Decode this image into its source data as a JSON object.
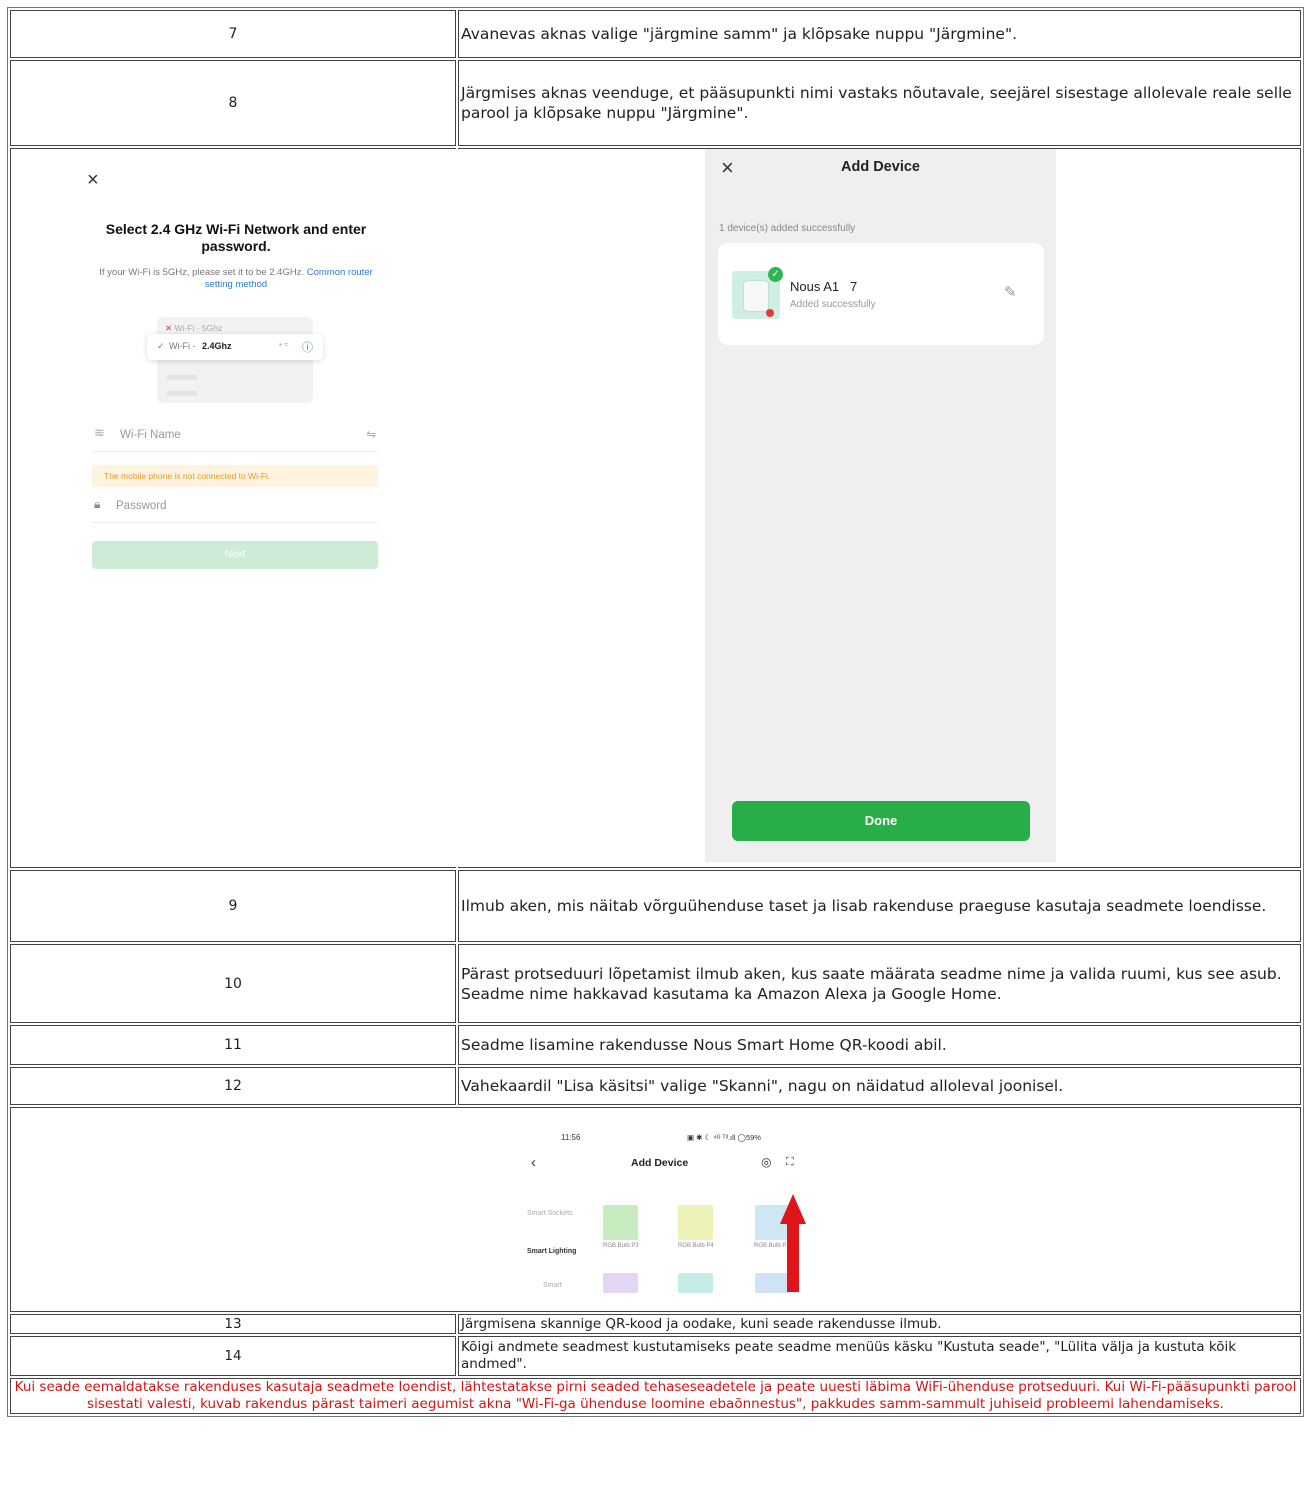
{
  "steps": {
    "s7": {
      "num": "7",
      "text": "Avanevas aknas valige \"järgmine samm\" ja klõpsake nuppu \"Järgmine\"."
    },
    "s8": {
      "num": "8",
      "text": "Järgmises aknas veenduge, et pääsupunkti nimi vastaks nõutavale, seejärel sisestage allolevale reale selle parool ja klõpsake nuppu \"Järgmine\"."
    },
    "s9": {
      "num": "9",
      "text": "Ilmub aken, mis näitab võrguühenduse taset ja lisab rakenduse praeguse kasutaja seadmete loendisse."
    },
    "s10": {
      "num": "10",
      "text": "Pärast protseduuri lõpetamist ilmub aken, kus saate määrata seadme nime ja valida ruumi, kus see asub. Seadme nime hakkavad kasutama ka Amazon Alexa ja Google Home."
    },
    "s11": {
      "num": "11",
      "text": "Seadme lisamine rakendusse Nous Smart Home QR-koodi abil."
    },
    "s12": {
      "num": "12",
      "text": "Vahekaardil \"Lisa käsitsi\" valige \"Skanni\", nagu on näidatud alloleval joonisel."
    },
    "s13": {
      "num": "13",
      "text": "Järgmisena skannige QR-kood ja oodake, kuni seade rakendusse ilmub."
    },
    "s14": {
      "num": "14",
      "text": "Kõigi andmete seadmest kustutamiseks peate seadme menüüs käsku \"Kustuta seade\", \"Lülita välja ja kustuta kõik andmed\"."
    }
  },
  "wifi_screen": {
    "close": "×",
    "title": "Select 2.4 GHz Wi-Fi Network and enter password.",
    "subtitle": "If your Wi-Fi is 5GHz, please set it to be 2.4GHz.",
    "subtitle_link": "Common router setting method",
    "net_5g": "Wi-Fi - 5Ghz",
    "net_24_prefix": "Wi-Fi - ",
    "net_24_bold": "2.4Ghz",
    "wifi_name_placeholder": "Wi-Fi Name",
    "warning": "The mobile phone is not connected to Wi-Fi.",
    "password_placeholder": "Password",
    "next": "Next"
  },
  "add_screen": {
    "close": "×",
    "title": "Add Device",
    "status": "1 device(s) added successfully",
    "device_name": "Nous A1   7",
    "device_status": "Added successfully",
    "done": "Done"
  },
  "scan_screen": {
    "time": "11:56",
    "status_icons": "▣ ✱ ☾ ⁴ᴳ ᵀˡˡ.ıll ◯59%",
    "title": "Add Device",
    "categories": [
      "Smart Sockets",
      "Smart Lighting",
      "Smart"
    ],
    "tiles": [
      "RGB Bulb P3",
      "RGB Bulb P4",
      "RGB Bulb P"
    ]
  },
  "note": "Kui seade eemaldatakse rakenduses kasutaja seadmete loendist, lähtestatakse pirni seaded tehaseseadetele ja peate uuesti läbima WiFi-ühenduse protseduuri. Kui Wi-Fi-pääsupunkti parool sisestati valesti, kuvab rakendus pärast taimeri aegumist akna \"Wi-Fi-ga ühenduse loomine ebaõnnestus\", pakkudes samm-sammult juhiseid probleemi lahendamiseks.",
  "colors": {
    "accent_green": "#27ae48",
    "link_blue": "#2d7bd8",
    "note_red": "#d01515",
    "arrow_red": "#e0141b"
  }
}
